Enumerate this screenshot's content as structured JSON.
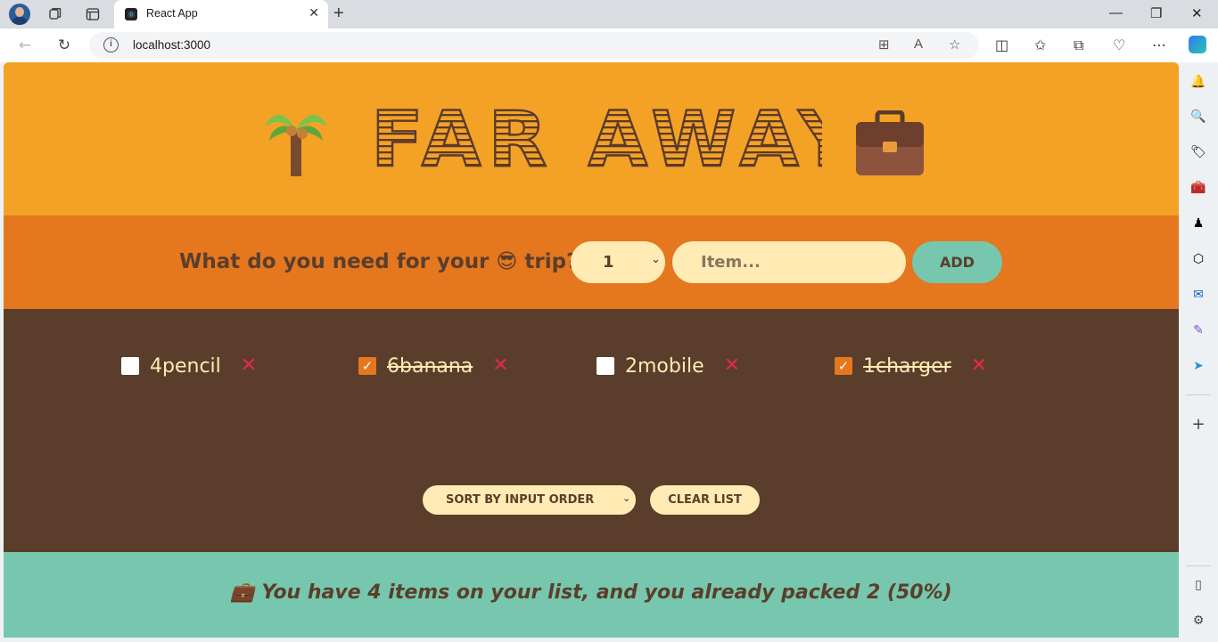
{
  "browser": {
    "tab_title": "React App",
    "url": "localhost:3000",
    "new_tab_symbol": "+",
    "tab_close_symbol": "✕"
  },
  "app": {
    "brand_title": "FAR AWAY",
    "header_left_emoji": "🌴",
    "header_right_emoji": "💼",
    "form": {
      "question": "What do you need for your 😎 trip?",
      "quantity_value": "1",
      "item_placeholder": "Item...",
      "add_label": "Add"
    },
    "items": [
      {
        "label": "4pencil",
        "packed": false,
        "check_mark": ""
      },
      {
        "label": "6banana",
        "packed": true,
        "check_mark": "✓"
      },
      {
        "label": "2mobile",
        "packed": false,
        "check_mark": ""
      },
      {
        "label": "1charger",
        "packed": true,
        "check_mark": "✓"
      }
    ],
    "delete_symbol": "✕",
    "sort_label": "Sort by input order",
    "clear_label": "Clear list",
    "stats": "💼 You have 4 items on your list, and you already packed 2 (50%)"
  },
  "colors": {
    "header": "#f4a226",
    "form_bar": "#e5771f",
    "list_bg": "#5a3e2b",
    "stats_bg": "#76c7ad",
    "cream": "#ffebb3",
    "delete_red": "#e5284b"
  }
}
